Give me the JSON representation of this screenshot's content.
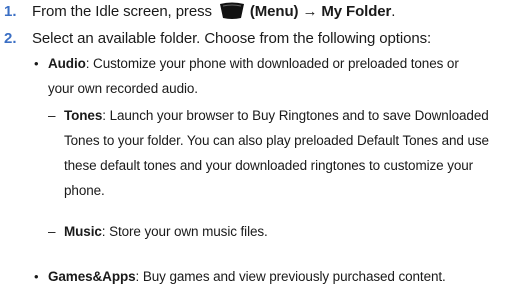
{
  "steps": [
    {
      "num": "1.",
      "prefix": "From the Idle screen, press",
      "menu_label": "(Menu)",
      "arrow": "→",
      "target": "My Folder",
      "suffix": "."
    },
    {
      "num": "2.",
      "text": "Select an available folder. Choose from the following options:"
    }
  ],
  "options": {
    "audio": {
      "term": "Audio",
      "desc_line1": ": Customize your phone with downloaded or preloaded tones or",
      "desc_line2": "your own recorded audio."
    },
    "tones": {
      "term": "Tones",
      "desc_line1": ": Launch your browser to Buy Ringtones and to save Downloaded",
      "desc_line2": "Tones to your folder. You can also play preloaded Default Tones and use",
      "desc_line3": "these default tones and your downloaded ringtones to customize your",
      "desc_line4": "phone."
    },
    "music": {
      "term": "Music",
      "desc": ": Store your own music files."
    },
    "games": {
      "term": "Games&Apps",
      "desc": ": Buy games and view previously purchased content."
    }
  },
  "glyphs": {
    "bullet": "•",
    "dash": "–"
  },
  "icons": {
    "menu_key": "menu-softkey-icon"
  },
  "colors": {
    "step_number": "#3b6fc4",
    "text": "#1a1a1a"
  }
}
